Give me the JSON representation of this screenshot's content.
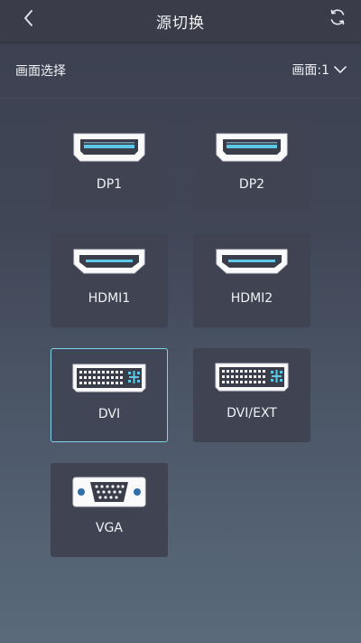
{
  "header": {
    "title": "源切换",
    "back_icon": "chevron-left-icon",
    "refresh_icon": "refresh-icon"
  },
  "picture": {
    "label": "画面选择",
    "value": "画面:1",
    "dropdown_icon": "chevron-down-icon"
  },
  "sources": [
    {
      "label": "DP1",
      "icon": "displayport-icon",
      "selected": false
    },
    {
      "label": "DP2",
      "icon": "displayport-icon",
      "selected": false
    },
    {
      "label": "HDMI1",
      "icon": "hdmi-icon",
      "selected": false
    },
    {
      "label": "HDMI2",
      "icon": "hdmi-icon",
      "selected": false
    },
    {
      "label": "DVI",
      "icon": "dvi-icon",
      "selected": true
    },
    {
      "label": "DVI/EXT",
      "icon": "dvi-icon",
      "selected": false
    },
    {
      "label": "VGA",
      "icon": "vga-icon",
      "selected": false
    }
  ],
  "colors": {
    "selected_border": "#7fd3ea",
    "connector_accent": "#5bc8e8",
    "tile_background": "#3f4352"
  }
}
